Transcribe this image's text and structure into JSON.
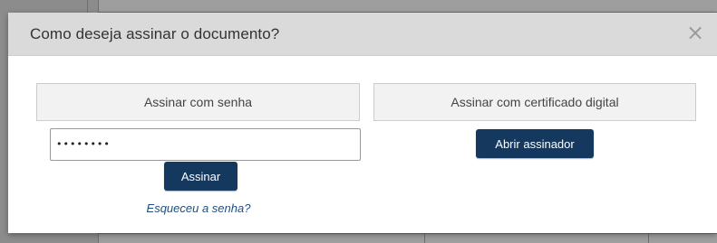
{
  "dialog": {
    "title": "Como deseja assinar o documento?",
    "close_symbol": "×"
  },
  "tabs": {
    "password_label": "Assinar com senha",
    "certificate_label": "Assinar com certificado digital"
  },
  "password": {
    "value": "••••••••"
  },
  "buttons": {
    "sign_label": "Assinar",
    "open_signer_label": "Abrir assinador"
  },
  "links": {
    "forgot_password": "Esqueceu a senha?"
  },
  "colors": {
    "primary_button": "#14385e",
    "link": "#1f4e84",
    "header_bg": "#dadada",
    "overlay": "#8c8c8c"
  }
}
